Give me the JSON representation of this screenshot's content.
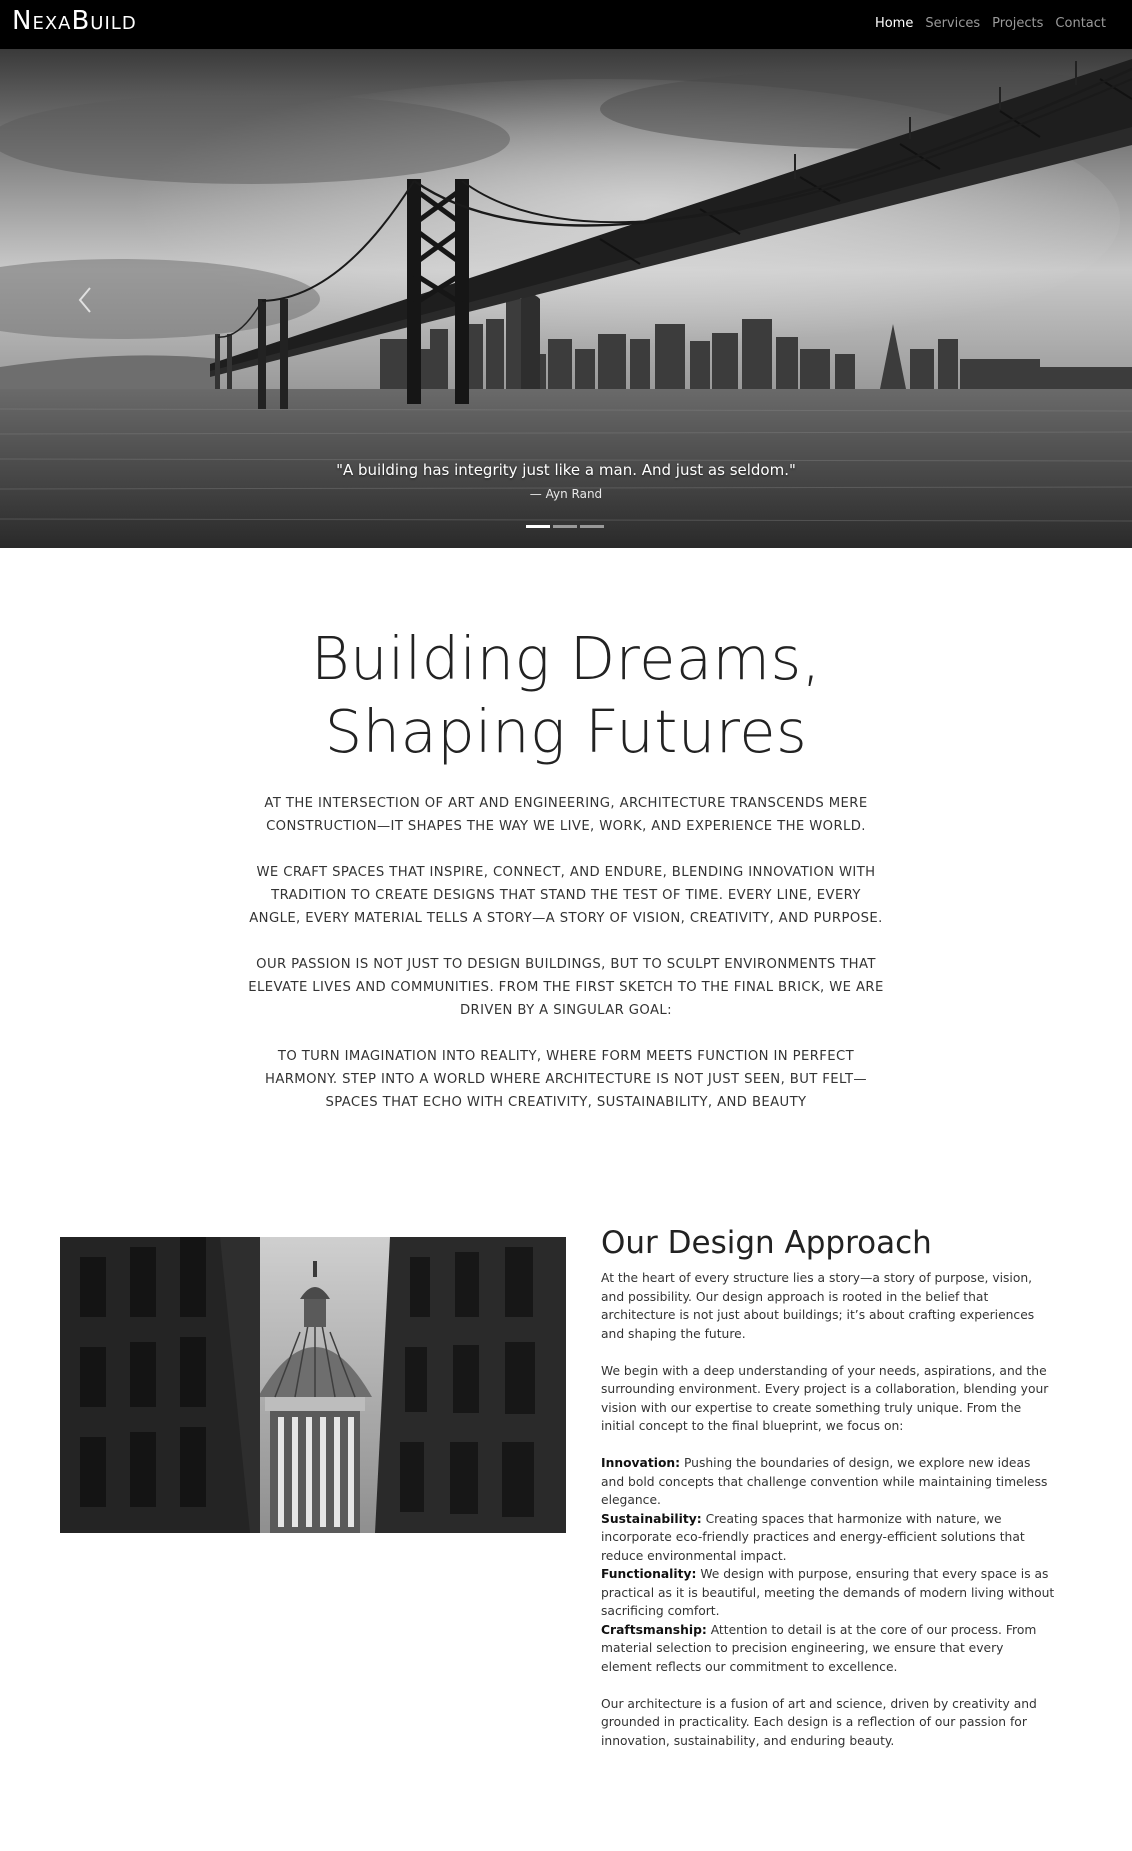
{
  "nav": {
    "brand": "NexaBuild",
    "links": [
      {
        "label": "Home",
        "active": true
      },
      {
        "label": "Services",
        "active": false
      },
      {
        "label": "Projects",
        "active": false
      },
      {
        "label": "Contact",
        "active": false
      }
    ]
  },
  "hero": {
    "quote": "\"A building has integrity just like a man. And just as seldom.\"",
    "author": "— Ayn Rand",
    "slide_count": 3,
    "active_slide": 1,
    "prev_icon": "chevron-left-icon"
  },
  "intro": {
    "title_line1": "Building Dreams,",
    "title_line2": "Shaping Futures",
    "paragraphs": [
      "At the intersection of art and engineering, architecture transcends mere construction—it shapes the way we live, work, and experience the world.",
      "We craft spaces that inspire, connect, and endure, blending innovation with tradition to create designs that stand the test of time. Every line, every angle, every material tells a story—a story of vision, creativity, and purpose.",
      "Our passion is not just to design buildings, but to sculpt environments that elevate lives and communities. From the first sketch to the final brick, we are driven by a singular goal:",
      "To turn imagination into reality, where form meets function in perfect harmony. Step into a world where architecture is not just seen, but felt—spaces that echo with creativity, sustainability, and beauty"
    ]
  },
  "approach": {
    "heading": "Our Design Approach",
    "para1": "At the heart of every structure lies a story—a story of purpose, vision, and possibility. Our design approach is rooted in the belief that architecture is not just about buildings; it’s about crafting experiences and shaping the future.",
    "para2": "We begin with a deep understanding of your needs, aspirations, and the surrounding environment. Every project is a collaboration, blending your vision with our expertise to create something truly unique. From the initial concept to the final blueprint, we focus on:",
    "focus": [
      {
        "term": "Innovation:",
        "text": "Pushing the boundaries of design, we explore new ideas and bold concepts that challenge convention while maintaining timeless elegance."
      },
      {
        "term": "Sustainability:",
        "text": "Creating spaces that harmonize with nature, we incorporate eco-friendly practices and energy-efficient solutions that reduce environmental impact."
      },
      {
        "term": "Functionality:",
        "text": "We design with purpose, ensuring that every space is as practical as it is beautiful, meeting the demands of modern living without sacrificing comfort."
      },
      {
        "term": "Craftsmanship:",
        "text": "Attention to detail is at the core of our process. From material selection to precision engineering, we ensure that every element reflects our commitment to excellence."
      }
    ],
    "para3": "Our architecture is a fusion of art and science, driven by creativity and grounded in practicality. Each design is a reflection of our passion for innovation, sustainability, and enduring beauty."
  }
}
